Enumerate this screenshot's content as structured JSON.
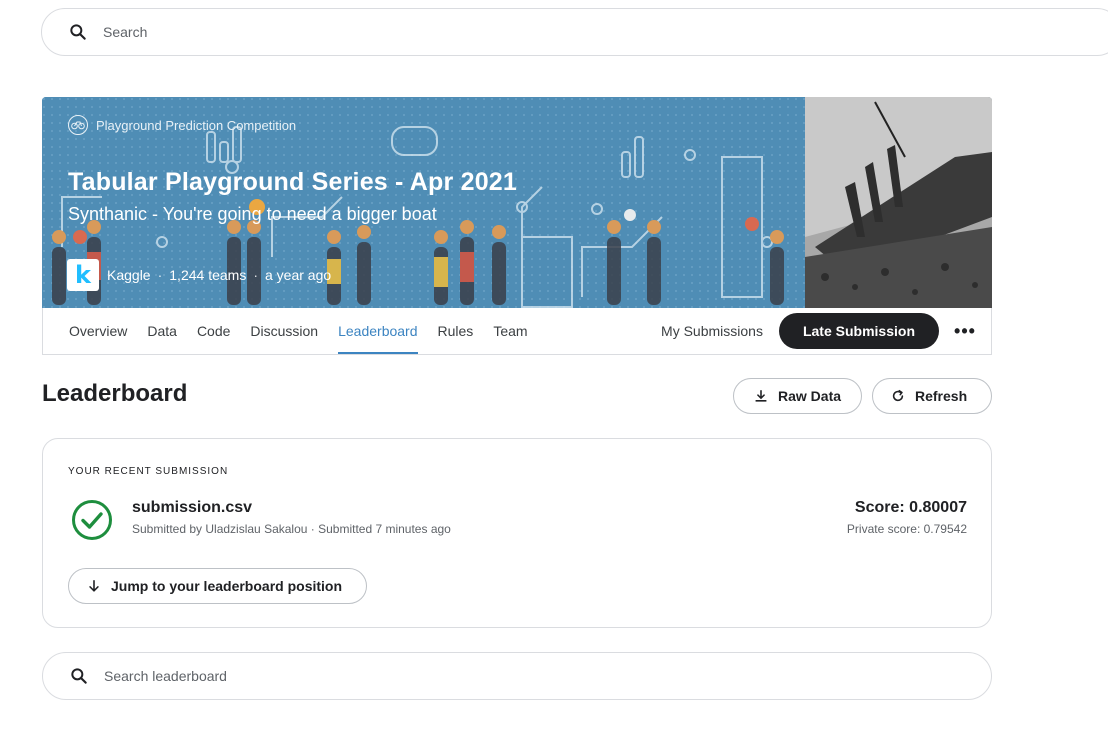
{
  "search": {
    "placeholder": "Search"
  },
  "hero": {
    "badge": "Playground Prediction Competition",
    "title": "Tabular Playground Series - Apr 2021",
    "subtitle": "Synthanic - You're going to need a bigger boat",
    "host": "Kaggle",
    "teams": "1,244 teams",
    "age": "a year ago",
    "logo_letter": "k"
  },
  "tabs": [
    {
      "label": "Overview"
    },
    {
      "label": "Data"
    },
    {
      "label": "Code"
    },
    {
      "label": "Discussion"
    },
    {
      "label": "Leaderboard",
      "active": true
    },
    {
      "label": "Rules"
    },
    {
      "label": "Team"
    }
  ],
  "tabs_right": {
    "my_submissions": "My Submissions",
    "late_submission": "Late Submission",
    "more": "•••"
  },
  "leaderboard": {
    "title": "Leaderboard",
    "raw_data": "Raw Data",
    "refresh": "Refresh"
  },
  "recent": {
    "label": "YOUR RECENT SUBMISSION",
    "file": "submission.csv",
    "meta": "Submitted by Uladzislau Sakalou · Submitted 7 minutes ago",
    "score": "Score: 0.80007",
    "private_score": "Private score: 0.79542",
    "jump": "Jump to your leaderboard position"
  },
  "lb_search": {
    "placeholder": "Search leaderboard"
  },
  "colors": {
    "accent": "#3c84c1",
    "dark_button": "#202124",
    "success": "#1e8e3e",
    "hero_bg": "#4f8db5"
  }
}
